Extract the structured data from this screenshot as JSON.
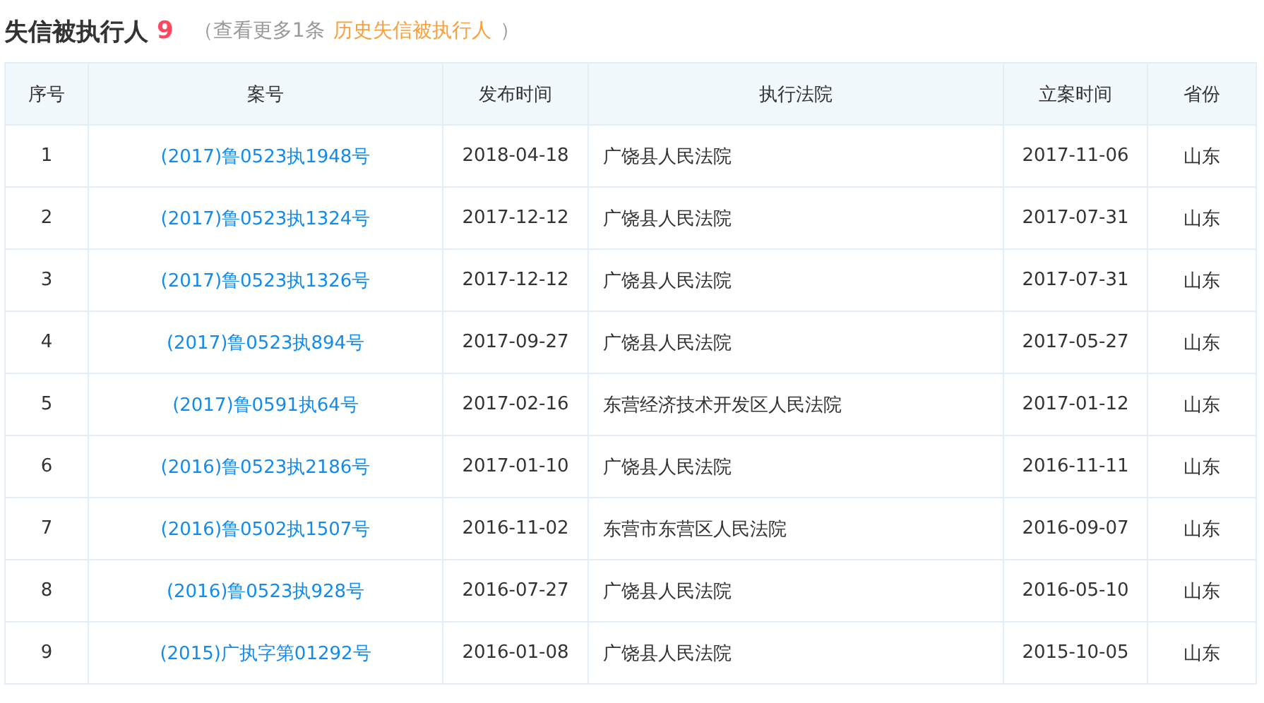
{
  "title": "失信被执行人",
  "count": "9",
  "note": {
    "open": "（",
    "text": "查看更多1条",
    "link": "历史失信被执行人",
    "close": "）"
  },
  "table": {
    "columns": [
      "序号",
      "案号",
      "发布时间",
      "执行法院",
      "立案时间",
      "省份"
    ],
    "rows": [
      [
        "1",
        "(2017)鲁0523执1948号",
        "2018-04-18",
        "广饶县人民法院",
        "2017-11-06",
        "山东"
      ],
      [
        "2",
        "(2017)鲁0523执1324号",
        "2017-12-12",
        "广饶县人民法院",
        "2017-07-31",
        "山东"
      ],
      [
        "3",
        "(2017)鲁0523执1326号",
        "2017-12-12",
        "广饶县人民法院",
        "2017-07-31",
        "山东"
      ],
      [
        "4",
        "(2017)鲁0523执894号",
        "2017-09-27",
        "广饶县人民法院",
        "2017-05-27",
        "山东"
      ],
      [
        "5",
        "(2017)鲁0591执64号",
        "2017-02-16",
        "东营经济技术开发区人民法院",
        "2017-01-12",
        "山东"
      ],
      [
        "6",
        "(2016)鲁0523执2186号",
        "2017-01-10",
        "广饶县人民法院",
        "2016-11-11",
        "山东"
      ],
      [
        "7",
        "(2016)鲁0502执1507号",
        "2016-11-02",
        "东营市东营区人民法院",
        "2016-09-07",
        "山东"
      ],
      [
        "8",
        "(2016)鲁0523执928号",
        "2016-07-27",
        "广饶县人民法院",
        "2016-05-10",
        "山东"
      ],
      [
        "9",
        "(2015)广执字第01292号",
        "2016-01-08",
        "广饶县人民法院",
        "2015-10-05",
        "山东"
      ]
    ]
  }
}
